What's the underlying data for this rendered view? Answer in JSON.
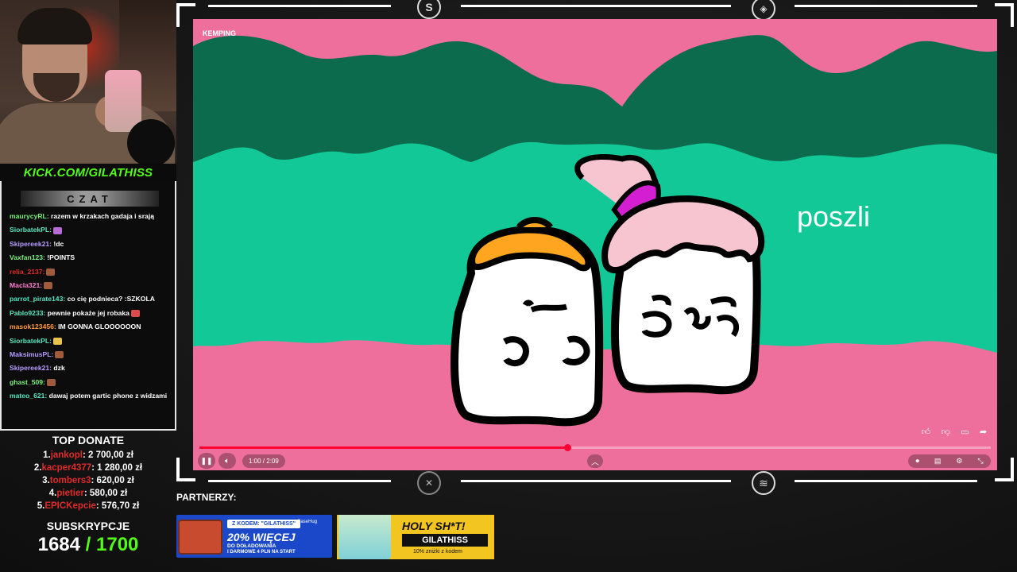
{
  "stream": {
    "kick_url": "KICK.COM/GILATHISS"
  },
  "chat": {
    "header": "CZAT",
    "messages": [
      {
        "user": "maurycyRL:",
        "text": " razem w krzakach gadaja i srają",
        "color": "#7df07d"
      },
      {
        "user": "SiorbatekPL:",
        "text": "",
        "color": "#55e6c1",
        "emote": "#b86ad6"
      },
      {
        "user": "Skipereek21:",
        "text": " !dc",
        "color": "#b59bff"
      },
      {
        "user": "Vaxfan123:",
        "text": " !POINTS",
        "color": "#7df07d"
      },
      {
        "user": "relia_2137:",
        "text": "",
        "color": "#e02a2a",
        "emote": "#a05a3c"
      },
      {
        "user": "Macla321:",
        "text": "",
        "color": "#ff7fd0",
        "emote": "#a05a3c"
      },
      {
        "user": "parrot_pirate143:",
        "text": " co cię podnieca? :SZKOLA",
        "color": "#55e6c1"
      },
      {
        "user": "Pablo9233:",
        "text": " pewnie pokaże jej robaka",
        "color": "#55e6c1",
        "emote": "#d84c4c"
      },
      {
        "user": "masok123456:",
        "text": " IM GONNA GLOOOOOON",
        "color": "#ff9b3a"
      },
      {
        "user": "SiorbatekPL:",
        "text": "",
        "color": "#55e6c1",
        "emote": "#e8c24a"
      },
      {
        "user": "MaksimusPL:",
        "text": "",
        "color": "#b59bff",
        "emote": "#a05a3c"
      },
      {
        "user": "Skipereek21:",
        "text": " dzk",
        "color": "#b59bff"
      },
      {
        "user": "ghast_509:",
        "text": "",
        "color": "#7df07d",
        "emote": "#a05a3c"
      },
      {
        "user": "mateo_621:",
        "text": " dawaj potem gartic phone z widzami",
        "color": "#55e6c1"
      }
    ]
  },
  "top_donate": {
    "title": "TOP DONATE",
    "entries": [
      {
        "rank": "1.",
        "name": "jankopl",
        "amount": ": 2 700,00 zł"
      },
      {
        "rank": "2.",
        "name": "kacper4377",
        "amount": ": 1 280,00 zł"
      },
      {
        "rank": "3.",
        "name": "tombers3",
        "amount": ": 620,00 zł"
      },
      {
        "rank": "4.",
        "name": "pietier",
        "amount": ": 580,00 zł"
      },
      {
        "rank": "5.",
        "name": "EPICKepcie",
        "amount": ": 576,70 zł"
      }
    ]
  },
  "subs": {
    "title": "SUBSKRYPCJE",
    "current": "1684",
    "goal": "/ 1700"
  },
  "video": {
    "title": "KEMPING",
    "subtitle": "poszli",
    "time": "1:00 / 2:09",
    "progress": 0.4651
  },
  "partners": {
    "label": "PARTNERZY:",
    "sponsor1": {
      "code": "Z KODEM: \"GILATHISS\"",
      "brand": "CaseHug",
      "headline": "20% WIĘCEJ",
      "line1": "DO DOŁADOWANIA",
      "line2": "I DARMOWE 4 PLN NA START"
    },
    "sponsor2": {
      "headline": "HOLY SH*T!",
      "code": "GILATHISS",
      "note": "10% zniżki z kodem"
    }
  },
  "colors": {
    "kick_green": "#53fc18",
    "progress_red": "#ff0033",
    "bg_pink": "#ef6f9c",
    "bush_teal": "#12c896",
    "tree_dark": "#0c6b4d"
  }
}
